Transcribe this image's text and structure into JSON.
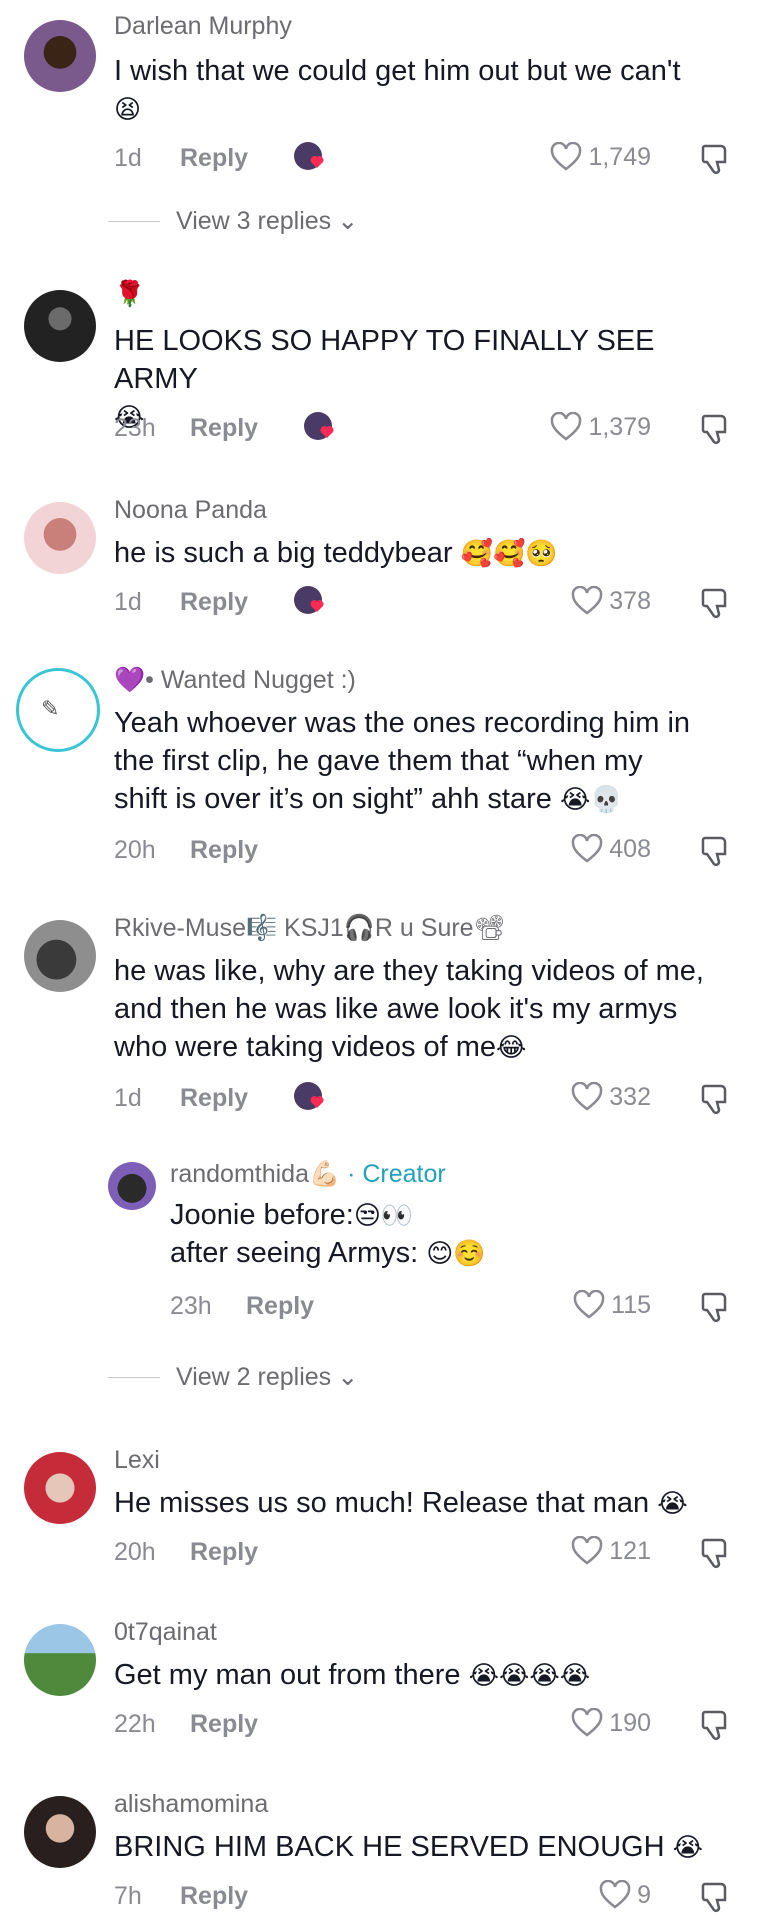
{
  "comments": [
    {
      "author": "Darlean Murphy",
      "text": "I wish that we could get him out but we can't",
      "emoji": "😫",
      "time": "1d",
      "reply": "Reply",
      "likes": "1,749",
      "creator_liked": true,
      "view_replies": "View 3 replies"
    },
    {
      "author_icon": "🌹",
      "text": "HE LOOKS SO HAPPY TO FINALLY SEE ARMY",
      "emoji": "😭",
      "time": "23h",
      "reply": "Reply",
      "likes": "1,379",
      "creator_liked": true
    },
    {
      "author": "Noona Panda",
      "text": "he is such a big teddybear",
      "emoji": "🥰🥰🥺",
      "time": "1d",
      "reply": "Reply",
      "likes": "378",
      "creator_liked": true
    },
    {
      "author_prefix": "💜•",
      "author": "Wanted Nugget :)",
      "text_lines": [
        "Yeah whoever was the ones recording him in",
        "the first clip, he gave them that “when my",
        "shift is over it’s on sight” ahh stare"
      ],
      "emoji": "😭💀",
      "time": "20h",
      "reply": "Reply",
      "likes": "408",
      "creator_liked": false
    },
    {
      "author": "Rkive-Muse🎼 KSJ1🎧R u Sure📽",
      "text_lines": [
        "he was like, why are they taking videos of me,",
        "and then he was like awe look it's my armys",
        "who were taking videos of me"
      ],
      "emoji": "😂",
      "time": "1d",
      "reply": "Reply",
      "likes": "332",
      "creator_liked": true
    },
    {
      "reply_author": "randomthida",
      "author_badge": "💪🏻",
      "creator_label": "· Creator",
      "text_lines": [
        "Joonie before:",
        "after seeing Armys:"
      ],
      "emoji_lines": [
        "😒👀",
        "😊☺️"
      ],
      "time": "23h",
      "reply": "Reply",
      "likes": "115",
      "view_replies": "View 2 replies"
    },
    {
      "author": "Lexi",
      "text": "He misses us so much! Release that man",
      "emoji": "😭",
      "time": "20h",
      "reply": "Reply",
      "likes": "121",
      "creator_liked": false
    },
    {
      "author": "0t7qainat",
      "text": "Get my man out from there",
      "emoji": "😭😭😭😭",
      "time": "22h",
      "reply": "Reply",
      "likes": "190",
      "creator_liked": false
    },
    {
      "author": "alishamomina",
      "text": "BRING HIM BACK HE SERVED ENOUGH",
      "emoji": "😭",
      "time": "7h",
      "reply": "Reply",
      "likes": "9",
      "creator_liked": false
    }
  ],
  "colors": {
    "accent_creator": "#21a2b8",
    "like_heart": "#ff2b55",
    "text_secondary": "#8a8b91"
  }
}
